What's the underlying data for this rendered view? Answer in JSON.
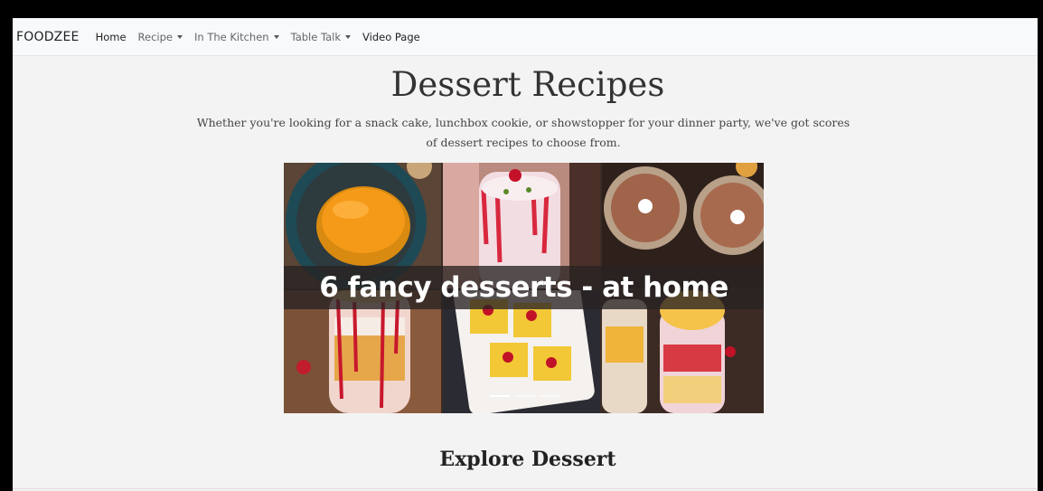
{
  "navbar": {
    "brand": "FOODZEE",
    "items": [
      {
        "label": "Home",
        "dropdown": false
      },
      {
        "label": "Recipe",
        "dropdown": true
      },
      {
        "label": "In The Kitchen",
        "dropdown": true
      },
      {
        "label": "Table Talk",
        "dropdown": true
      },
      {
        "label": "Video Page",
        "dropdown": false
      }
    ]
  },
  "hero": {
    "title": "Dessert Recipes",
    "lead_line1": "Whether you're looking for a snack cake, lunchbox cookie, or showstopper for your dinner party, we've got scores",
    "lead_line2": "of dessert recipes to choose from."
  },
  "carousel": {
    "caption": "6 fancy desserts - at home",
    "slide_count": 3,
    "active_slide": 1
  },
  "section": {
    "heading": "Explore Dessert"
  }
}
